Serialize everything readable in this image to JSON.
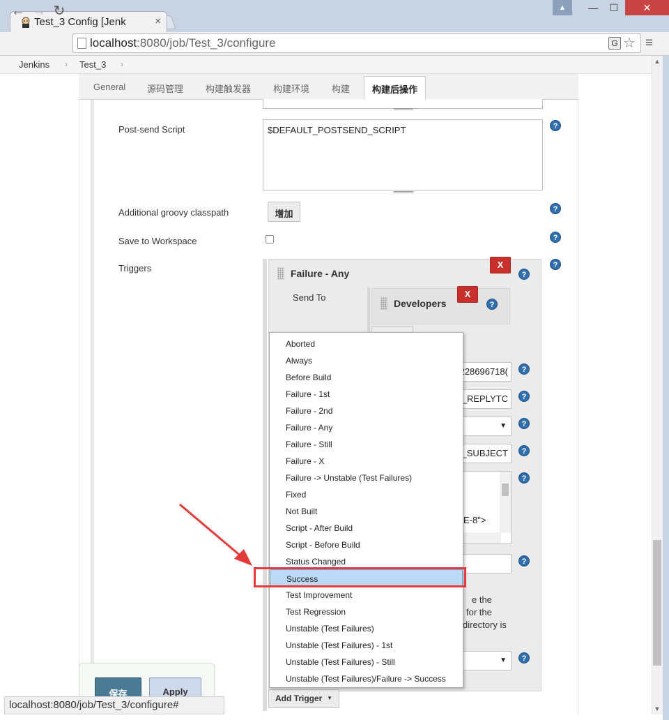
{
  "browser": {
    "tab_title": "Test_3 Config [Jenk",
    "tab_close": "×",
    "url_host": "localhost",
    "url_rest": ":8080/job/Test_3/configure",
    "window_user": "▲",
    "window_min": "—",
    "window_max": "☐",
    "window_close": "✕",
    "back": "←",
    "forward": "→",
    "reload": "↻",
    "star": "☆",
    "menu": "≡",
    "translate": "G"
  },
  "breadcrumb": {
    "items": [
      "Jenkins",
      "Test_3"
    ],
    "sep": "›"
  },
  "tabs": [
    "General",
    "源码管理",
    "构建触发器",
    "构建环境",
    "构建",
    "构建后操作"
  ],
  "form": {
    "post_send_label": "Post-send Script",
    "post_send_value": "$DEFAULT_POSTSEND_SCRIPT",
    "groovy_label": "Additional groovy classpath",
    "groovy_add": "增加",
    "save_ws_label": "Save to Workspace",
    "triggers_label": "Triggers",
    "help": "?"
  },
  "trigger": {
    "title": "Failure - Any",
    "delete": "X",
    "send_to_label": "Send To",
    "developers": "Developers",
    "field1": "228696718(",
    "field2": "_REPLYTC",
    "field4": "_SUBJECT",
    "content_line": "E-8\">",
    "partial_text_1": "e the",
    "partial_text_2": "for the",
    "partial_text_3": "directory is",
    "add_trigger": "Add Trigger"
  },
  "dropdown": {
    "items": [
      "Aborted",
      "Always",
      "Before Build",
      "Failure - 1st",
      "Failure - 2nd",
      "Failure - Any",
      "Failure - Still",
      "Failure - X",
      "Failure -> Unstable (Test Failures)",
      "Fixed",
      "Not Built",
      "Script - After Build",
      "Script - Before Build",
      "Status Changed",
      "Success",
      "Test Improvement",
      "Test Regression",
      "Unstable (Test Failures)",
      "Unstable (Test Failures) - 1st",
      "Unstable (Test Failures) - Still",
      "Unstable (Test Failures)/Failure -> Success"
    ],
    "selected": "Success"
  },
  "buttons": {
    "save": "保存",
    "apply": "Apply"
  },
  "status_bar": "localhost:8080/job/Test_3/configure#",
  "colors": {
    "accent_red": "#e53a3a",
    "help_blue": "#2f6fad",
    "save_blue": "#4a7a94"
  }
}
